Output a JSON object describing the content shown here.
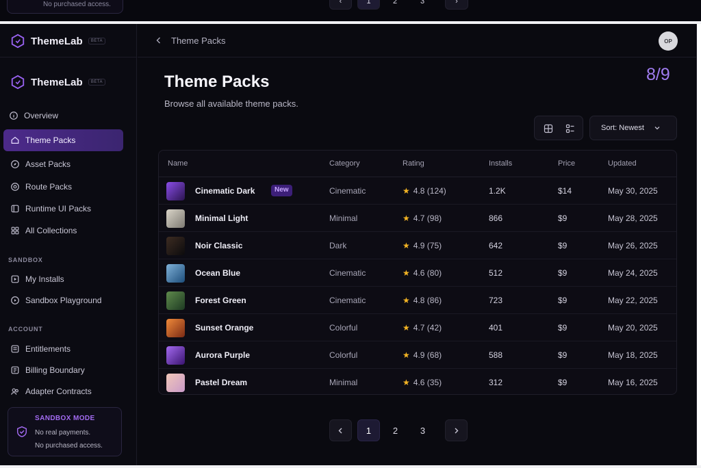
{
  "top_strip": {
    "sandbox_text": "No purchased access.",
    "pages": [
      "1",
      "2",
      "3"
    ]
  },
  "app": {
    "brand_name": "ThemeLab",
    "brand_badge": "BETA"
  },
  "sidebar": {
    "items": [
      {
        "label": "Overview",
        "icon": "info-circle-icon"
      },
      {
        "label": "Theme Packs",
        "icon": "home-icon",
        "active": true
      },
      {
        "label": "Asset Packs",
        "icon": "compass-icon"
      },
      {
        "label": "Route Packs",
        "icon": "target-icon"
      },
      {
        "label": "Runtime UI Packs",
        "icon": "layout-icon"
      },
      {
        "label": "All Collections",
        "icon": "grid-icon"
      }
    ],
    "sandbox_label": "SANDBOX",
    "sandbox_items": [
      {
        "label": "My Installs",
        "icon": "play-square-icon"
      },
      {
        "label": "Sandbox Playground",
        "icon": "play-circle-icon"
      }
    ],
    "account_label": "ACCOUNT",
    "account_items": [
      {
        "label": "Entitlements",
        "icon": "list-icon"
      },
      {
        "label": "Billing Boundary",
        "icon": "card-icon"
      },
      {
        "label": "Adapter Contracts",
        "icon": "users-icon"
      }
    ],
    "sandbox_card": {
      "title": "SANDBOX MODE",
      "line1": "No real payments.",
      "line2": "No purchased access."
    }
  },
  "header": {
    "breadcrumb": "Theme Packs",
    "avatar_initials": "OP"
  },
  "main": {
    "title": "Theme Packs",
    "subtitle": "Browse all available theme packs.",
    "count": "8/9",
    "sort_label": "Sort: Newest"
  },
  "table": {
    "columns": [
      "Name",
      "Category",
      "Rating",
      "Installs",
      "Price",
      "Updated"
    ],
    "rows": [
      {
        "name": "Cinematic Dark",
        "badge": "New",
        "category": "Cinematic",
        "rating": "4.8 (124)",
        "installs": "1.2K",
        "price": "$14",
        "updated": "May 30, 2025",
        "thumb": [
          "#2b1450",
          "#8a4de8"
        ]
      },
      {
        "name": "Minimal Light",
        "badge": "",
        "category": "Minimal",
        "rating": "4.7 (98)",
        "installs": "866",
        "price": "$9",
        "updated": "May 28, 2025",
        "thumb": [
          "#7d7a72",
          "#d9d4c8"
        ]
      },
      {
        "name": "Noir Classic",
        "badge": "",
        "category": "Dark",
        "rating": "4.9 (75)",
        "installs": "642",
        "price": "$9",
        "updated": "May 26, 2025",
        "thumb": [
          "#0c0b0d",
          "#3d2c22"
        ]
      },
      {
        "name": "Ocean Blue",
        "badge": "",
        "category": "Cinematic",
        "rating": "4.6 (80)",
        "installs": "512",
        "price": "$9",
        "updated": "May 24, 2025",
        "thumb": [
          "#1d4d7a",
          "#7fb1d8"
        ]
      },
      {
        "name": "Forest Green",
        "badge": "",
        "category": "Cinematic",
        "rating": "4.8 (86)",
        "installs": "723",
        "price": "$9",
        "updated": "May 22, 2025",
        "thumb": [
          "#1d3a22",
          "#5f8a4c"
        ]
      },
      {
        "name": "Sunset Orange",
        "badge": "",
        "category": "Colorful",
        "rating": "4.7 (42)",
        "installs": "401",
        "price": "$9",
        "updated": "May 20, 2025",
        "thumb": [
          "#7a2a14",
          "#f08a3a"
        ]
      },
      {
        "name": "Aurora Purple",
        "badge": "",
        "category": "Colorful",
        "rating": "4.9 (68)",
        "installs": "588",
        "price": "$9",
        "updated": "May 18, 2025",
        "thumb": [
          "#3a1470",
          "#a46af0"
        ]
      },
      {
        "name": "Pastel Dream",
        "badge": "",
        "category": "Minimal",
        "rating": "4.6 (35)",
        "installs": "312",
        "price": "$9",
        "updated": "May 16, 2025",
        "thumb": [
          "#c99ac8",
          "#f1c7b9"
        ]
      }
    ]
  },
  "pagination": {
    "pages": [
      "1",
      "2",
      "3"
    ],
    "current": "1"
  },
  "colors": {
    "accent": "#8b5cf6",
    "active_nav": "#4c2a8a",
    "star": "#f5b524",
    "background": "#0a0a10"
  }
}
